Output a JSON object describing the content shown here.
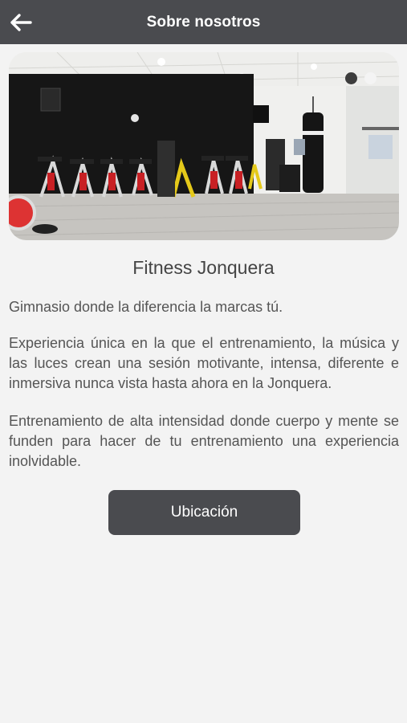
{
  "header": {
    "title": "Sobre nosotros",
    "back_icon": "arrow-left-icon"
  },
  "carousel": {
    "total_slides": 2,
    "active_slide": 1,
    "image_description": "gym-spinning-room-photo"
  },
  "about": {
    "name": "Fitness Jonquera",
    "paragraphs": [
      "Gimnasio donde la diferencia la marcas tú.",
      "Experiencia única en la que el entrenamiento, la música y las luces crean una sesión motivante, intensa, diferente e inmersiva nunca vista hasta ahora en la Jonquera.",
      "Entrenamiento de alta intensidad donde cuerpo y mente se funden para hacer de tu entrenamiento una experiencia inolvidable."
    ]
  },
  "actions": {
    "location_label": "Ubicación"
  },
  "colors": {
    "header_bg": "#4a4b4f",
    "page_bg": "#f3f3f3",
    "button_bg": "#4a4b4f"
  }
}
